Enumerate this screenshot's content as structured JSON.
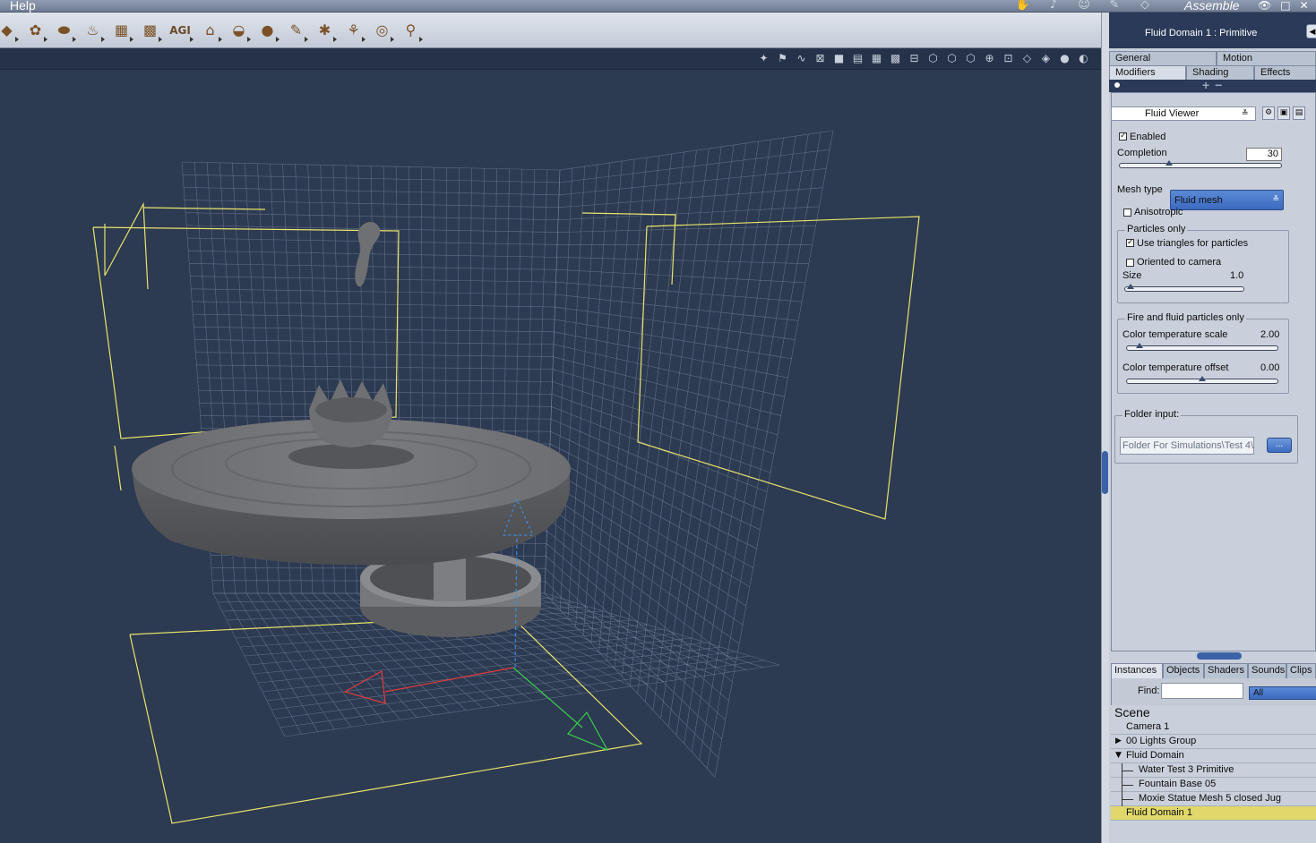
{
  "menubar": {
    "help": "Help",
    "room": "Assemble",
    "room_icons": [
      "hand-icon",
      "figure-icon",
      "face-icon",
      "pen-icon",
      "tag-icon"
    ],
    "window_controls": [
      "👁",
      "□",
      "✕"
    ]
  },
  "toolbar": {
    "tools": [
      {
        "name": "sun-tool",
        "glyph": "◆"
      },
      {
        "name": "tree-tool",
        "glyph": "✿"
      },
      {
        "name": "plane-tool",
        "glyph": "⬬"
      },
      {
        "name": "fire-tool",
        "glyph": "♨"
      },
      {
        "name": "terrain-tool",
        "glyph": "▦"
      },
      {
        "name": "terrain2-tool",
        "glyph": "▩"
      },
      {
        "name": "agi-tool",
        "label": "AGI"
      },
      {
        "name": "house-tool",
        "glyph": "⌂"
      },
      {
        "name": "bowl-tool",
        "glyph": "◒"
      },
      {
        "name": "rock-tool",
        "glyph": "●"
      },
      {
        "name": "pin-tool",
        "glyph": "✎"
      },
      {
        "name": "bug-tool",
        "glyph": "✱"
      },
      {
        "name": "tripod-tool",
        "glyph": "⚘"
      },
      {
        "name": "target-tool",
        "glyph": "◎"
      },
      {
        "name": "bone-tool",
        "glyph": "⚲"
      }
    ]
  },
  "viewport_icons": [
    "✦",
    "⚑",
    "∿",
    "⊠",
    "■",
    "▤",
    "▦",
    "▩",
    "⊟",
    "⬡",
    "⬡",
    "⬡",
    "⊕",
    "⊡",
    "◇",
    "◈",
    "●",
    "◐"
  ],
  "panel": {
    "title": "Fluid Domain 1 : Primitive",
    "tabs_row1": [
      "General",
      "Motion"
    ],
    "tabs_row2": [
      "Modifiers",
      "Shading",
      "Effects"
    ],
    "modifier": "Fluid Viewer",
    "enabled_label": "Enabled",
    "completion_label": "Completion",
    "completion_value": "30",
    "completion_fraction": 0.3,
    "mesh_type_label": "Mesh type",
    "mesh_type_value": "Fluid mesh",
    "anisotropic_label": "Anisotropic",
    "particles_group": "Particles only",
    "use_triangles_label": "Use triangles for particles",
    "oriented_label": "Oriented to camera",
    "size_label": "Size",
    "size_value": "1.0",
    "fire_group": "Fire and fluid particles only",
    "color_scale_label": "Color temperature scale",
    "color_scale_value": "2.00",
    "color_offset_label": "Color temperature offset",
    "color_offset_value": "0.00",
    "folder_label": "Folder input:",
    "folder_value": "Folder For Simulations\\Test 4\\",
    "folder_button": "..."
  },
  "library": {
    "tabs": [
      "Instances",
      "Objects",
      "Shaders",
      "Sounds",
      "Clips"
    ],
    "find_label": "Find:",
    "find_value": "",
    "scope": "All",
    "scene_label": "Scene",
    "tree": [
      {
        "label": "Camera 1",
        "level": 0,
        "expander": ""
      },
      {
        "label": "00 Lights Group",
        "level": 0,
        "expander": "▶"
      },
      {
        "label": "Fluid Domain",
        "level": 0,
        "expander": "▼"
      },
      {
        "label": "Water Test 3 Primitive",
        "level": 1,
        "expander": ""
      },
      {
        "label": "Fountain Base 05",
        "level": 1,
        "expander": ""
      },
      {
        "label": "Moxie Statue Mesh 5 closed Jug",
        "level": 1,
        "expander": ""
      },
      {
        "label": "Fluid Domain 1",
        "level": 0,
        "expander": "",
        "selected": true
      }
    ]
  },
  "colors": {
    "viewport_bg": "#2c3a52",
    "grid": "#8c98ad",
    "bbox": "#e9e46a",
    "axis_x": "#e03a3a",
    "axis_y": "#3ad04a",
    "axis_z": "#3a8ce0",
    "mesh": "#6e6f72",
    "selection": "#e0d86a"
  }
}
